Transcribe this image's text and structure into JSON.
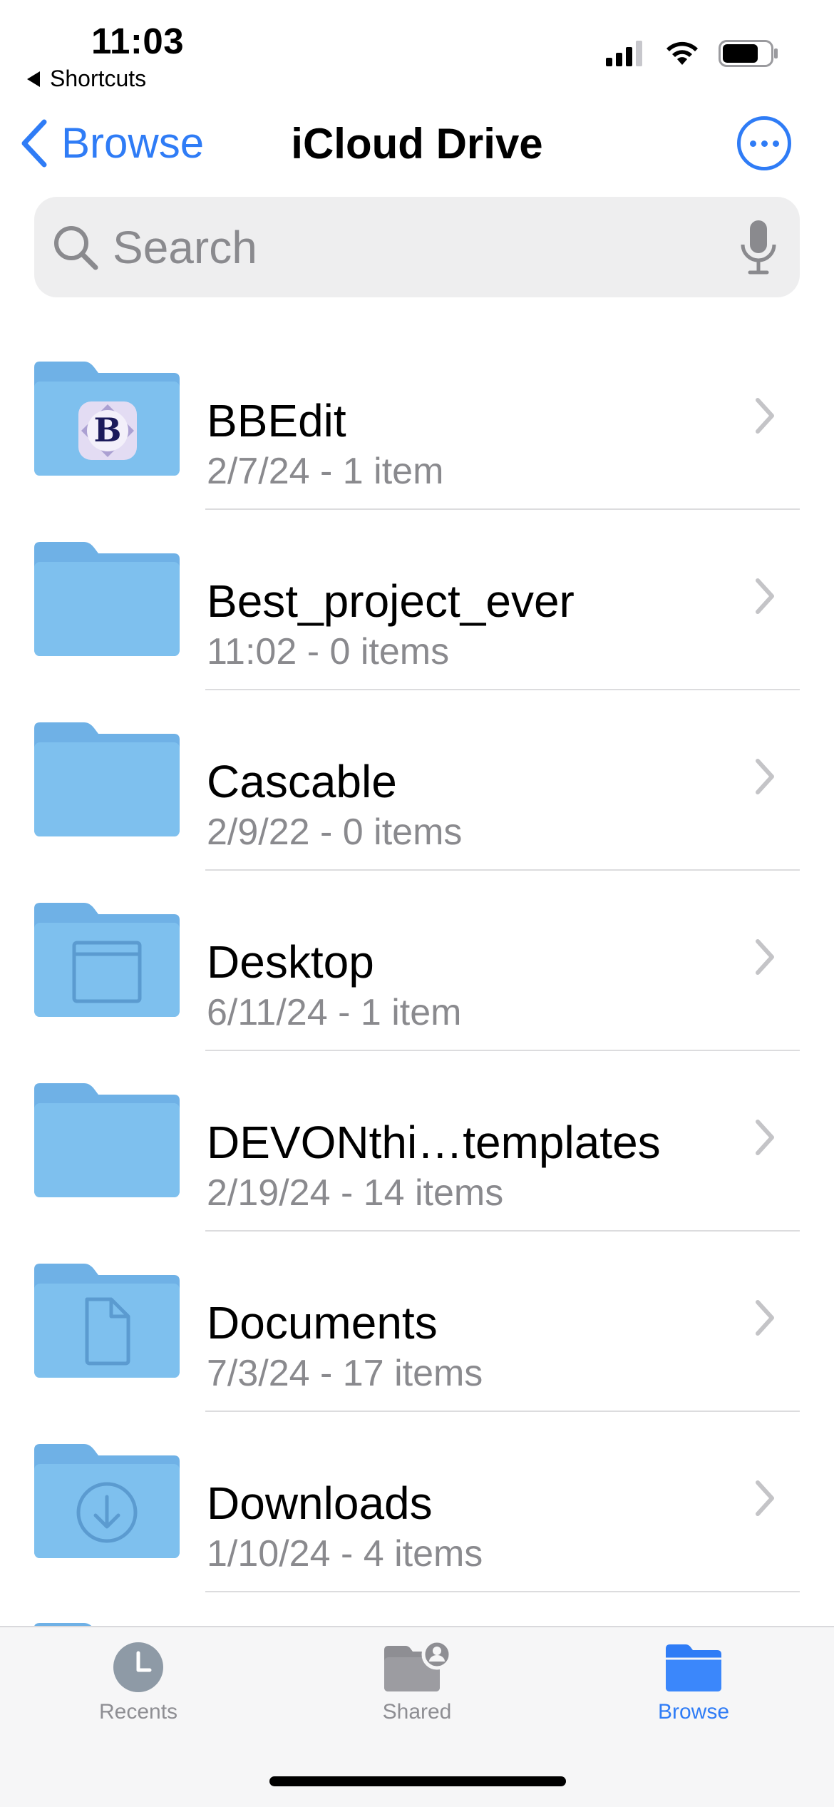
{
  "status_bar": {
    "time": "11:03",
    "back_app": "Shortcuts",
    "battery_level": 0.75
  },
  "nav": {
    "back_label": "Browse",
    "title": "iCloud Drive",
    "more_icon": "ellipsis-circle-icon"
  },
  "search": {
    "placeholder": "Search"
  },
  "folders": [
    {
      "name": "BBEdit",
      "meta": "2/7/24 - 1 item",
      "badge": "app-icon-bbedit"
    },
    {
      "name": "Best_project_ever",
      "meta": "11:02 - 0 items",
      "badge": ""
    },
    {
      "name": "Cascable",
      "meta": "2/9/22 - 0 items",
      "badge": ""
    },
    {
      "name": "Desktop",
      "meta": "6/11/24 - 1 item",
      "badge": "window-glyph"
    },
    {
      "name": "DEVONthi…templates",
      "meta": "2/19/24 - 14 items",
      "badge": ""
    },
    {
      "name": "Documents",
      "meta": "7/3/24 - 17 items",
      "badge": "document-glyph"
    },
    {
      "name": "Downloads",
      "meta": "1/10/24 - 4 items",
      "badge": "download-glyph"
    }
  ],
  "tabbar": {
    "tabs": [
      {
        "label": "Recents",
        "icon": "clock-icon",
        "active": false
      },
      {
        "label": "Shared",
        "icon": "shared-folder-icon",
        "active": false
      },
      {
        "label": "Browse",
        "icon": "folder-icon",
        "active": true
      }
    ]
  },
  "colors": {
    "accent": "#2f7cf6",
    "folder": "#7ec0ee",
    "secondary_text": "#8a8a8e"
  }
}
